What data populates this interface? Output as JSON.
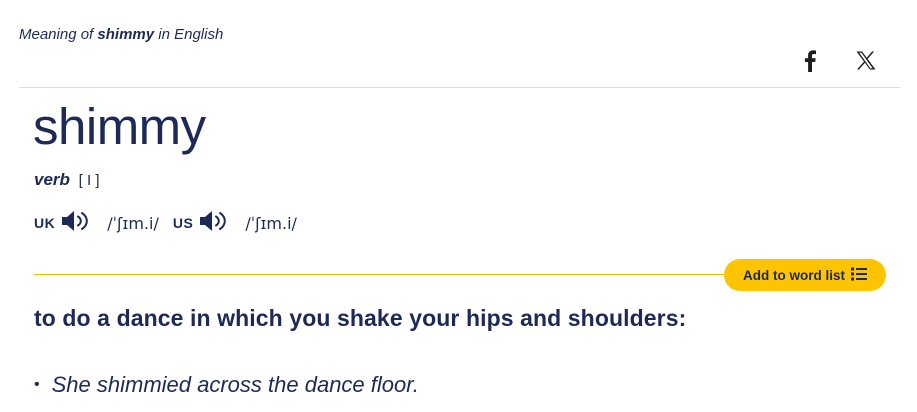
{
  "header": {
    "meaning_prefix": "Meaning of",
    "meaning_word": "shimmy",
    "meaning_suffix": "in English"
  },
  "social": {
    "facebook_icon": "facebook-icon",
    "x_icon": "x-icon"
  },
  "entry": {
    "headword": "shimmy",
    "part_of_speech": "verb",
    "grammar": "[ I ]",
    "pronunciations": [
      {
        "region": "UK",
        "ipa": "/ˈʃɪm.i/"
      },
      {
        "region": "US",
        "ipa": "/ˈʃɪm.i/"
      }
    ]
  },
  "actions": {
    "add_to_word_list": "Add to word list"
  },
  "sense": {
    "definition": "to do a dance in which you shake your hips and shoulders:",
    "examples": [
      "She shimmied across the dance floor."
    ]
  },
  "colors": {
    "text": "#1d2a57",
    "accent": "#fec400",
    "rule": "#dadde3"
  }
}
